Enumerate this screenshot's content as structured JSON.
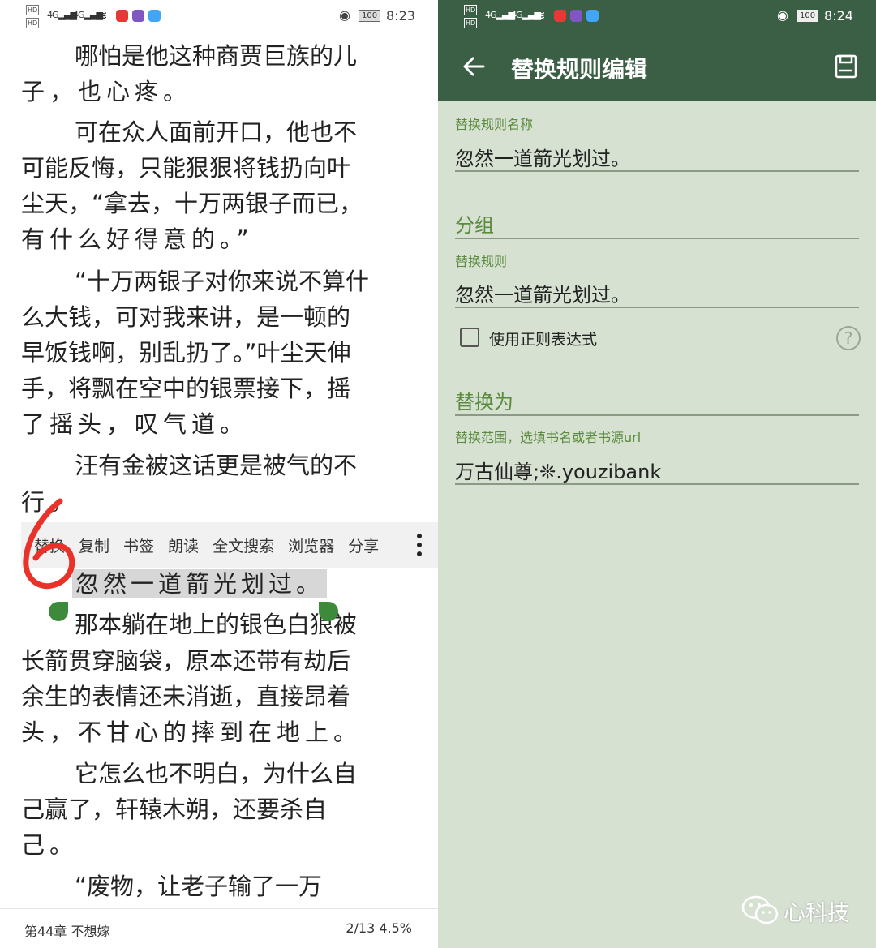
{
  "left_status": {
    "network_labels": [
      "HD",
      "HD"
    ],
    "signal_label": "4G",
    "battery": "100",
    "time": "8:23"
  },
  "reader": {
    "lines": [
      "哪怕是他这种商贾巨族的儿",
      "子，也心疼。",
      "可在众人面前开口，他也不",
      "可能反悔，只能狠狠将钱扔向叶",
      "尘天，“拿去，十万两银子而已，",
      "有什么好得意的。”",
      "“十万两银子对你来说不算什",
      "么大钱，可对我来讲，是一顿的",
      "早饭钱啊，别乱扔了。”叶尘天伸",
      "手，将飘在空中的银票接下，摇",
      "了摇头，叹气道。",
      "汪有金被这话更是被气的不",
      "行。",
      "那本躺在地上的银色白狼被",
      "长箭贯穿脑袋，原本还带有劫后",
      "余生的表情还未消逝，直接昂着",
      "头，不甘心的摔到在地上。",
      "它怎么也不明白，为什么自",
      "己赢了，轩辕木朔，还要杀自",
      "己。",
      "“废物，让老子输了一万"
    ],
    "selected_text": "忽然一道箭光划过。",
    "annotation_number": "6",
    "menu": [
      "替换",
      "复制",
      "书签",
      "朗读",
      "全文搜索",
      "浏览器",
      "分享"
    ],
    "chapter": "第44章 不想嫁",
    "progress": "2/13  4.5%"
  },
  "right_status": {
    "network_labels": [
      "HD",
      "HD"
    ],
    "signal_label": "4G",
    "battery": "100",
    "time": "8:24"
  },
  "editor": {
    "title": "替换规则编辑",
    "name_label": "替换规则名称",
    "name_value": "忽然一道箭光划过。",
    "group_hint": "分组",
    "rule_label": "替换规则",
    "rule_value": "忽然一道箭光划过。",
    "regex_label": "使用正则表达式",
    "regex_checked": false,
    "help_symbol": "?",
    "replace_hint": "替换为",
    "scope_label": "替换范围，选填书名或者书源url",
    "scope_value": "万古仙尊;❊.youzibank"
  },
  "watermark": {
    "text": "心科技"
  },
  "colors": {
    "appbar": "#3a5f45",
    "editor_bg": "#d6e1d2",
    "accent_green": "#5b8b3f",
    "handle_green": "#3c8a3a",
    "annotation_red": "#e8322a"
  }
}
